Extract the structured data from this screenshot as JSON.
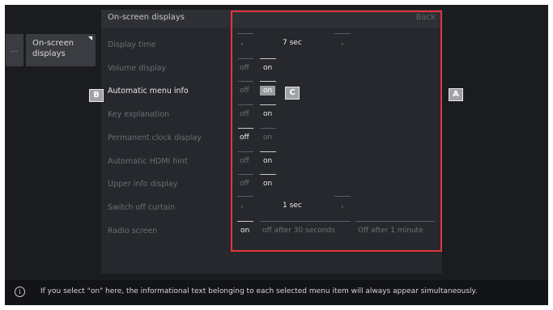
{
  "breadcrumb": {
    "dots": "...",
    "tab_line1": "On-screen",
    "tab_line2": "displays"
  },
  "panel": {
    "title": "On-screen displays",
    "back_label": "Back"
  },
  "rows": [
    {
      "label": "Display time",
      "type": "stepper",
      "value": "7 sec",
      "left": "‹",
      "right": "›"
    },
    {
      "label": "Volume display",
      "type": "toggle",
      "off": "off",
      "on": "on",
      "selected": "on"
    },
    {
      "label": "Automatic menu info",
      "type": "toggle",
      "off": "off",
      "on": "on",
      "selected": "on",
      "focused": true
    },
    {
      "label": "Key explanation",
      "type": "toggle",
      "off": "off",
      "on": "on",
      "selected": "on"
    },
    {
      "label": "Permanent clock display",
      "type": "toggle",
      "off": "off",
      "on": "on",
      "selected": "off"
    },
    {
      "label": "Automatic HDMI hint",
      "type": "toggle",
      "off": "off",
      "on": "on",
      "selected": "on"
    },
    {
      "label": "Upper info display",
      "type": "toggle",
      "off": "off",
      "on": "on",
      "selected": "on"
    },
    {
      "label": "Switch off curtain",
      "type": "stepper",
      "value": "1 sec",
      "left": "‹",
      "right": "›"
    },
    {
      "label": "Radio screen",
      "type": "triple",
      "options": [
        "on",
        "off after 30 seconds",
        "Off after 1 minute"
      ],
      "selected": "on"
    }
  ],
  "badges": {
    "a": "A",
    "b": "B",
    "c": "C"
  },
  "info": {
    "icon": "info-icon",
    "icon_glyph": "i",
    "text": "If you select \"on\" here, the informational text belonging to each selected menu item will always appear simultaneously."
  },
  "colors": {
    "highlight_frame": "#e2353b",
    "panel_bg": "#26282d",
    "screen_bg": "#1b1c1f"
  }
}
